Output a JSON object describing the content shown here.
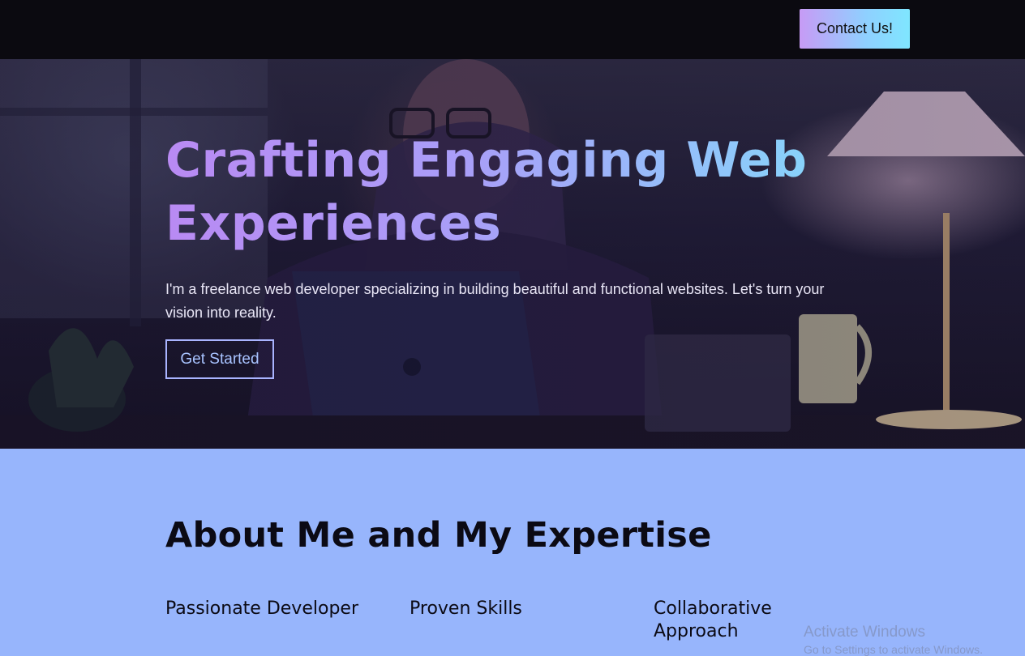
{
  "header": {
    "contact_label": "Contact Us!"
  },
  "hero": {
    "title": "Crafting Engaging Web Experiences",
    "subtitle": "I'm a freelance web developer specializing in building beautiful and functional websites. Let's turn your vision into reality.",
    "cta_label": "Get Started",
    "background_image": "developer-working-on-laptop-photo"
  },
  "about": {
    "title": "About Me and My Expertise",
    "features": [
      {
        "title": "Passionate Developer"
      },
      {
        "title": "Proven Skills"
      },
      {
        "title": "Collaborative Approach"
      }
    ]
  },
  "watermark": {
    "line1": "Activate Windows",
    "line2": "Go to Settings to activate Windows."
  },
  "colors": {
    "topbar": "#0b0a10",
    "about_background": "#97b5fc",
    "gradient_start": "#b98af3",
    "gradient_end": "#86d6fb",
    "cta_border": "#a9b4ff"
  }
}
